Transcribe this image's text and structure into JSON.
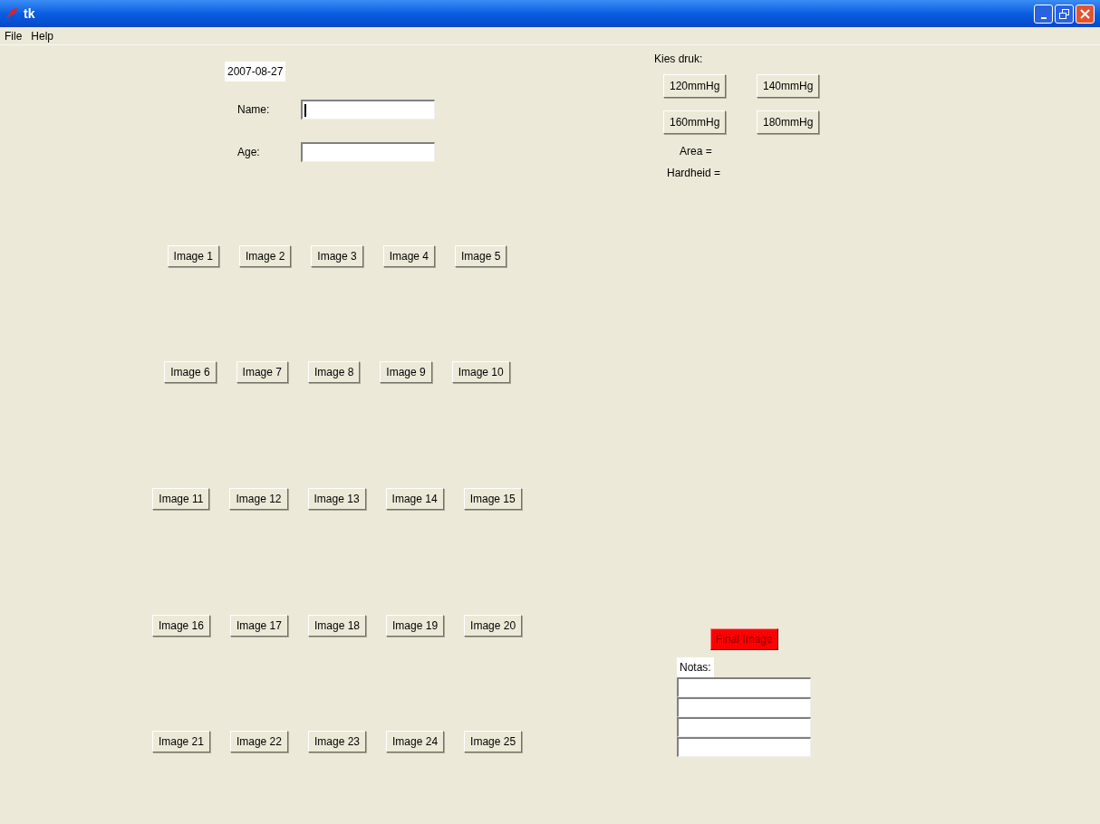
{
  "window": {
    "title": "tk"
  },
  "menu": [
    "File",
    "Help"
  ],
  "date": "2007-08-27",
  "form": [
    {
      "label": "Name:",
      "focused": true
    },
    {
      "label": "Age:",
      "focused": false
    }
  ],
  "image_rows": [
    [
      "Image 1",
      "Image 2",
      "Image 3",
      "Image 4",
      "Image 5"
    ],
    [
      "Image 6",
      "Image 7",
      "Image 8",
      "Image 9",
      "Image 10"
    ],
    [
      "Image 11",
      "Image 12",
      "Image 13",
      "Image 14",
      "Image 15"
    ],
    [
      "Image 16",
      "Image 17",
      "Image 18",
      "Image 19",
      "Image 20"
    ],
    [
      "Image 21",
      "Image 22",
      "Image 23",
      "Image 24",
      "Image 25"
    ]
  ],
  "pressure": {
    "label": "Kies druk:",
    "buttons": [
      "120mmHg",
      "140mmHg",
      "160mmHg",
      "180mmHg"
    ]
  },
  "results": [
    "Area =",
    "Hardheid ="
  ],
  "final_button": "Final Image",
  "notes": {
    "label": "Notas:",
    "lines": [
      {
        "kind": "entry"
      },
      {
        "kind": "entry"
      },
      {
        "kind": "entry"
      },
      {
        "kind": "entry"
      }
    ]
  }
}
